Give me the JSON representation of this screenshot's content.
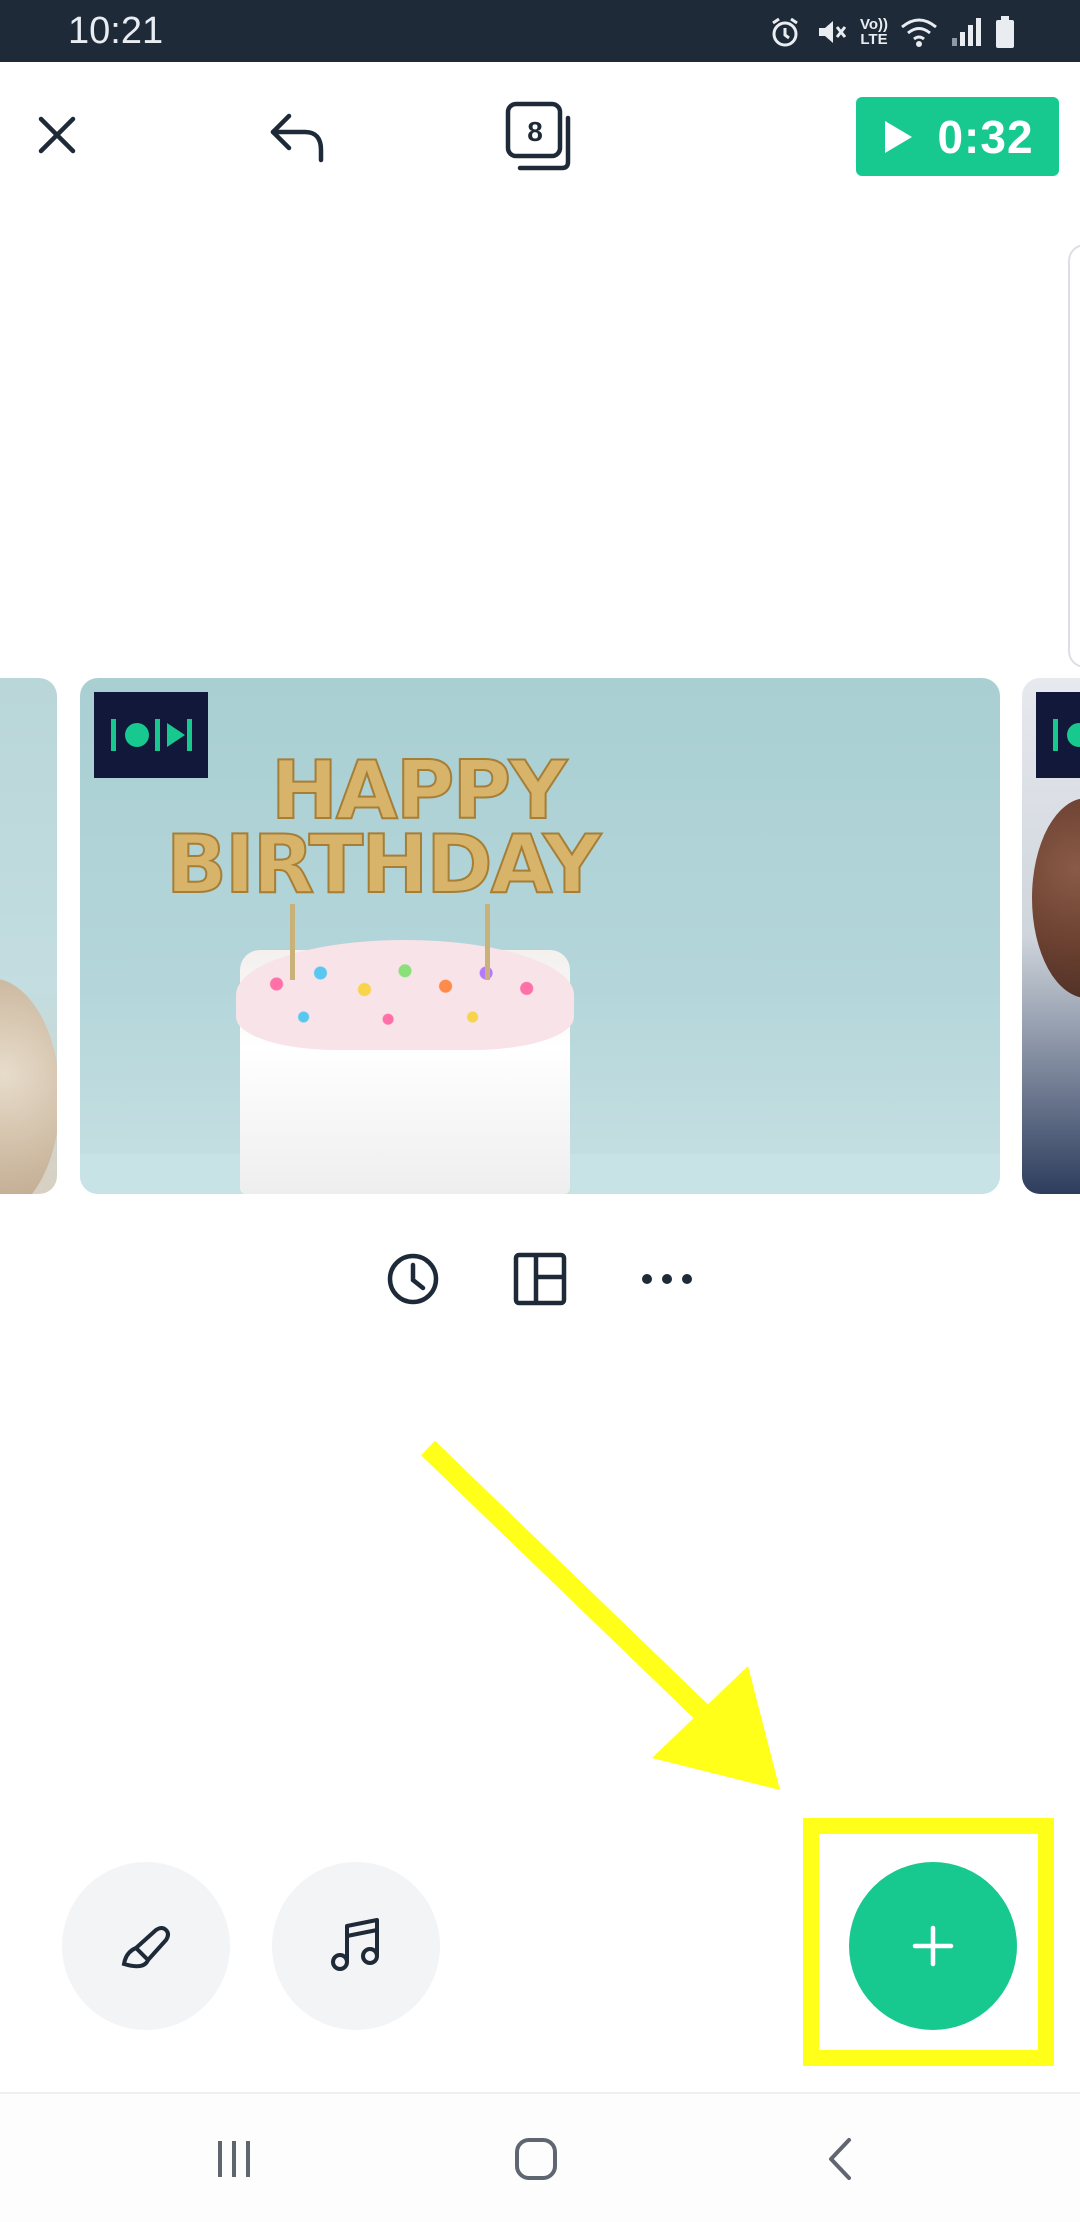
{
  "status_bar": {
    "time": "10:21",
    "icons": [
      "alarm-icon",
      "mute-icon",
      "volte-icon",
      "wifi-icon",
      "signal-icon",
      "battery-icon"
    ],
    "volte_label_top": "Vo))",
    "volte_label_bottom": "LTE"
  },
  "toolbar": {
    "close_icon": "close-icon",
    "undo_icon": "undo-icon",
    "slide_count": "8",
    "play_duration": "0:32"
  },
  "slides": {
    "main": {
      "badge_icon": "transition-icon",
      "cake_line1": "HAPPY",
      "cake_line2": "BIRTHDAY"
    }
  },
  "slide_tools": [
    "duration-icon",
    "layout-icon",
    "more-icon"
  ],
  "bottom_actions": {
    "brush_icon": "brush-icon",
    "music_icon": "music-icon",
    "add_icon": "plus-icon"
  },
  "colors": {
    "accent": "#18c98f",
    "status_bar": "#1e2a38",
    "annotation": "#ffff1a",
    "badge": "#12183a"
  },
  "nav_bar": [
    "recent-apps-icon",
    "home-icon",
    "back-icon"
  ]
}
